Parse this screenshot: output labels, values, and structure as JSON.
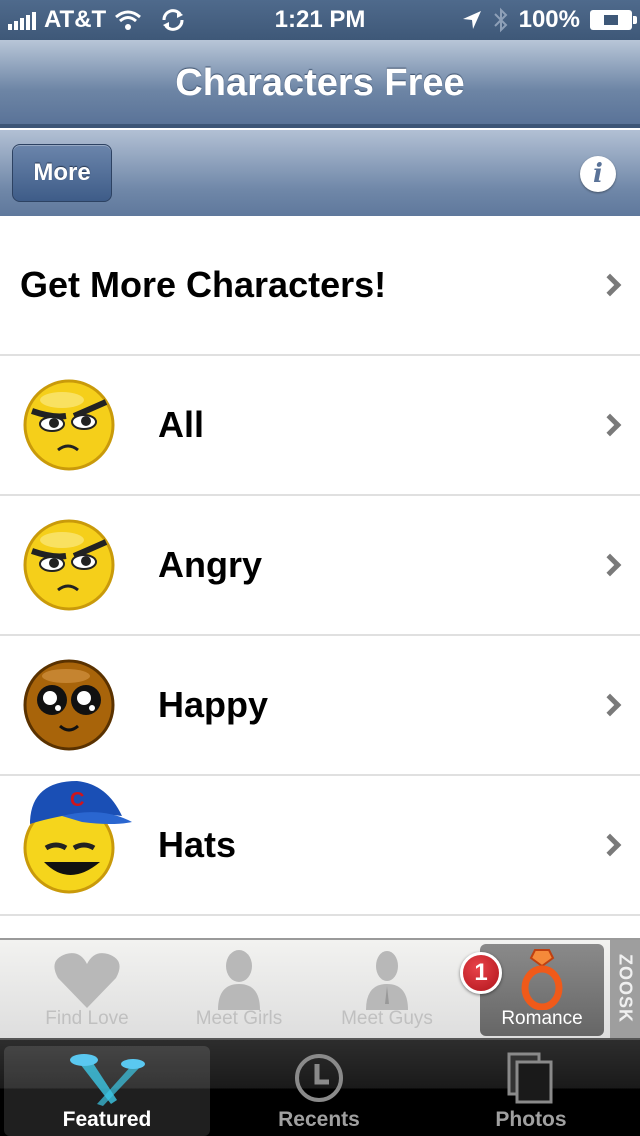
{
  "status_bar": {
    "carrier": "AT&T",
    "time": "1:21 PM",
    "battery": "100%"
  },
  "navbar": {
    "title": "Characters Free"
  },
  "toolbar": {
    "more_label": "More",
    "info_label": "i"
  },
  "list": {
    "get_more": "Get More Characters!",
    "items": [
      {
        "label": "All",
        "icon": "angry-face-icon"
      },
      {
        "label": "Angry",
        "icon": "angry-face-icon"
      },
      {
        "label": "Happy",
        "icon": "happy-brown-face-icon"
      },
      {
        "label": "Hats",
        "icon": "cap-face-icon"
      }
    ]
  },
  "ad_bar": {
    "items": [
      {
        "label": "Find Love",
        "icon": "heart-icon"
      },
      {
        "label": "Meet Girls",
        "icon": "woman-icon"
      },
      {
        "label": "Meet Guys",
        "icon": "man-icon"
      },
      {
        "label": "Romance",
        "icon": "ring-icon"
      }
    ],
    "badge": "1",
    "brand": "ZOOSK"
  },
  "tabbar": {
    "tabs": [
      {
        "label": "Featured",
        "icon": "spotlight-icon",
        "active": true
      },
      {
        "label": "Recents",
        "icon": "clock-icon",
        "active": false
      },
      {
        "label": "Photos",
        "icon": "photos-icon",
        "active": false
      }
    ]
  }
}
